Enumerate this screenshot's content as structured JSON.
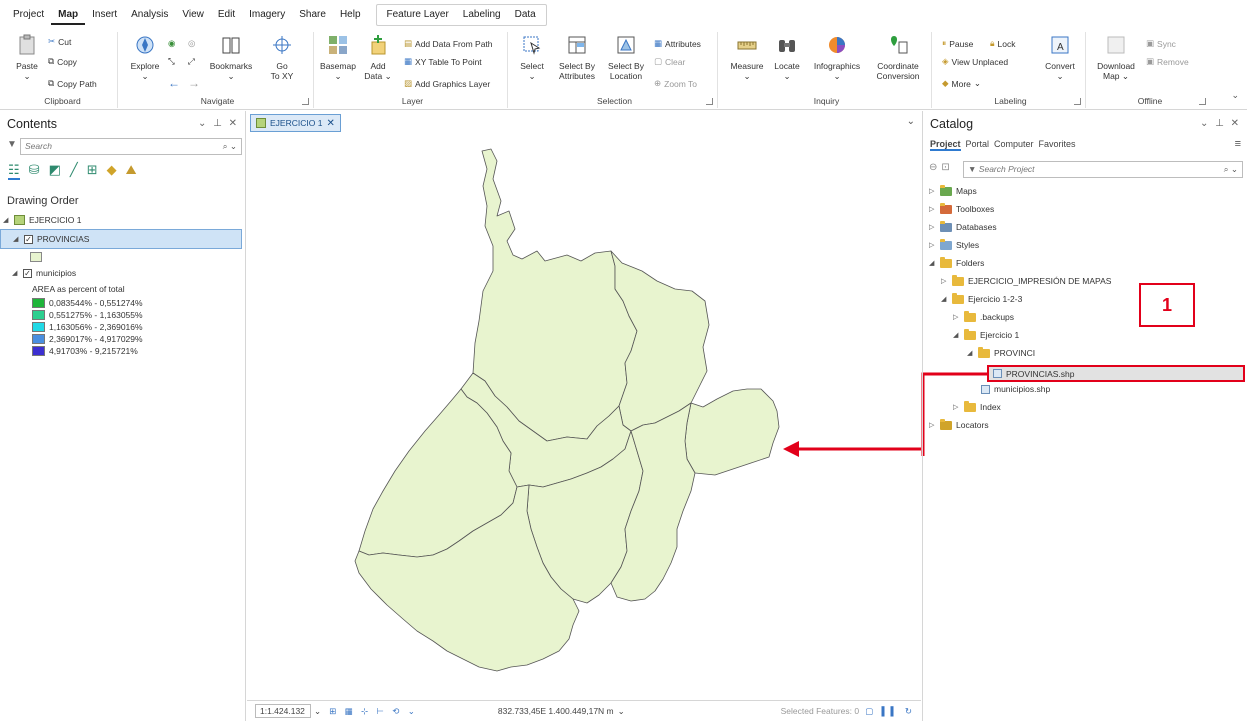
{
  "menu": {
    "tabs": [
      "Project",
      "Map",
      "Insert",
      "Analysis",
      "View",
      "Edit",
      "Imagery",
      "Share",
      "Help"
    ],
    "active_tab": "Map",
    "context_tabs": [
      "Feature Layer",
      "Labeling",
      "Data"
    ]
  },
  "ribbon": {
    "clipboard": {
      "label": "Clipboard",
      "paste": "Paste",
      "cut": "Cut",
      "copy": "Copy",
      "copy_path": "Copy Path"
    },
    "navigate": {
      "label": "Navigate",
      "explore": "Explore",
      "bookmarks": "Bookmarks",
      "go_to": "Go",
      "go_to_2": "To XY"
    },
    "layer": {
      "label": "Layer",
      "basemap": "Basemap",
      "add_data": "Add",
      "add_data_2": "Data",
      "add_from_path": "Add Data From Path",
      "xy_table": "XY Table To Point",
      "add_graphics": "Add Graphics Layer"
    },
    "selection": {
      "label": "Selection",
      "select": "Select",
      "by_attr": "Select By",
      "by_attr_2": "Attributes",
      "by_loc": "Select By",
      "by_loc_2": "Location",
      "attributes": "Attributes",
      "clear": "Clear",
      "zoom_to": "Zoom To"
    },
    "inquiry": {
      "label": "Inquiry",
      "measure": "Measure",
      "locate": "Locate",
      "infographics": "Infographics",
      "coord": "Coordinate",
      "coord_2": "Conversion"
    },
    "labeling": {
      "label": "Labeling",
      "pause": "Pause",
      "lock": "Lock",
      "view_unplaced": "View Unplaced",
      "more": "More",
      "convert": "Convert"
    },
    "offline": {
      "label": "Offline",
      "download": "Download",
      "download_2": "Map",
      "sync": "Sync",
      "remove": "Remove"
    }
  },
  "contents": {
    "title": "Contents",
    "search_placeholder": "Search",
    "drawing_order": "Drawing Order",
    "map_name": "EJERCICIO 1",
    "layer1": "PROVINCIAS",
    "layer2": "municipios",
    "legend_title": "AREA as percent of total",
    "legend": [
      {
        "label": "0,083544% - 0,551274%",
        "color": "#1fb53a"
      },
      {
        "label": "0,551275% - 1,163055%",
        "color": "#2ccf8f"
      },
      {
        "label": "1,163056% - 2,369016%",
        "color": "#21d9e6"
      },
      {
        "label": "2,369017% - 4,917029%",
        "color": "#4a8fe0"
      },
      {
        "label": "4,91703% - 9,215721%",
        "color": "#3c2fd0"
      }
    ],
    "fill_color": "#e8f4cf"
  },
  "map": {
    "tab_label": "EJERCICIO 1",
    "scale": "1:1.424.132",
    "coords": "832.733,45E 1.400.449,17N m",
    "selected_features": "Selected Features: 0",
    "polygon_fill": "#e8f4cf",
    "annotation_number": "1",
    "annotation_color": "#e2001a"
  },
  "catalog": {
    "title": "Catalog",
    "tabs": [
      "Project",
      "Portal",
      "Computer",
      "Favorites"
    ],
    "active_tab": "Project",
    "search_placeholder": "Search Project",
    "tree": {
      "maps": "Maps",
      "toolboxes": "Toolboxes",
      "databases": "Databases",
      "styles": "Styles",
      "folders": "Folders",
      "folder1": "EJERCICIO_IMPRESIÓN DE MAPAS",
      "folder2": "Ejercicio 1-2-3",
      "backups": ".backups",
      "ejercicio1": "Ejercicio 1",
      "provinci": "PROVINCI",
      "provincias_shp": "PROVINCIAS.shp",
      "municipios_shp": "municipios.shp",
      "index": "Index",
      "locators": "Locators"
    }
  }
}
